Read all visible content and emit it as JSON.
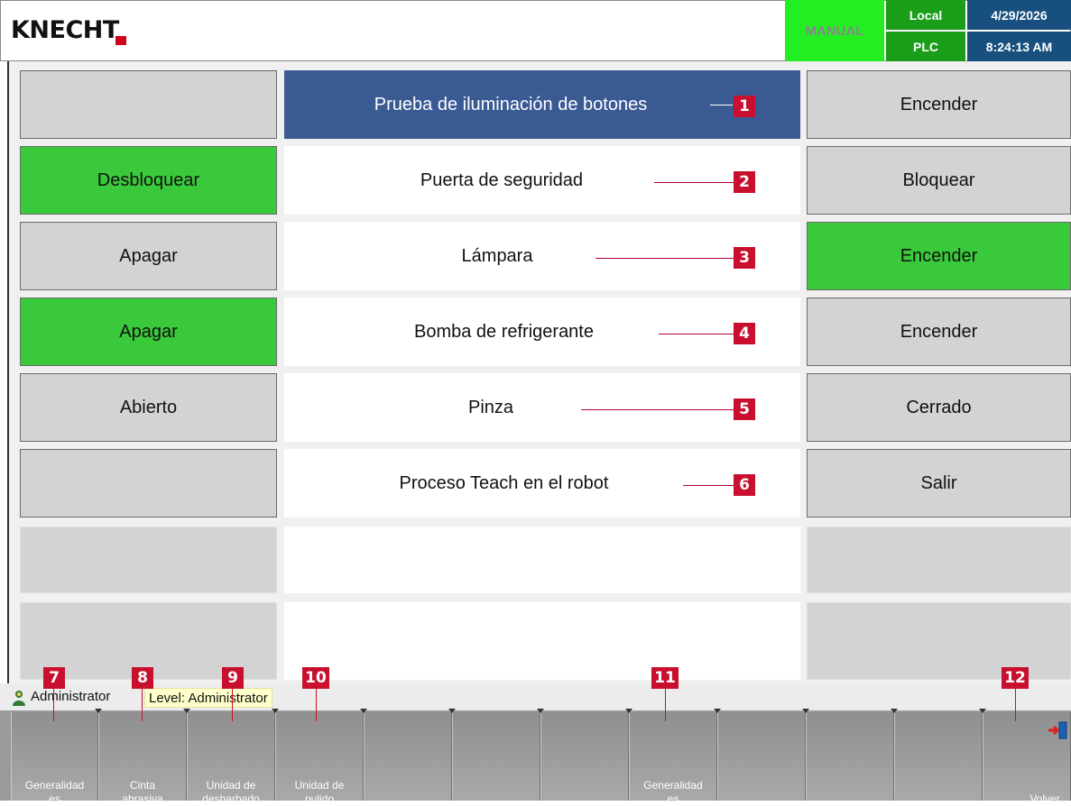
{
  "header": {
    "logo_text": "KNECHT",
    "mode": "MANUAL",
    "location": "Local",
    "source": "PLC",
    "date": "4/29/2026",
    "time": "8:24:13 AM"
  },
  "rows": [
    {
      "left": "",
      "left_state": "gray",
      "label": "Prueba de iluminación de botones",
      "right": "Encender",
      "right_state": "gray",
      "callout": "1",
      "highlight": true
    },
    {
      "left": "Desbloquear",
      "left_state": "green",
      "label": "Puerta de seguridad",
      "right": "Bloquear",
      "right_state": "gray",
      "callout": "2"
    },
    {
      "left": "Apagar",
      "left_state": "gray",
      "label": "Lámpara",
      "right": "Encender",
      "right_state": "green",
      "callout": "3"
    },
    {
      "left": "Apagar",
      "left_state": "green",
      "label": "Bomba de refrigerante",
      "right": "Encender",
      "right_state": "gray",
      "callout": "4"
    },
    {
      "left": "Abierto",
      "left_state": "gray",
      "label": "Pinza",
      "right": "Cerrado",
      "right_state": "gray",
      "callout": "5"
    },
    {
      "left": "",
      "left_state": "gray",
      "label": "Proceso Teach en el robot",
      "right": "Salir",
      "right_state": "gray",
      "callout": "6"
    }
  ],
  "status": {
    "user": "Administrator",
    "level": "Level: Administrator"
  },
  "function_keys": [
    {
      "label_1": "Generalidad",
      "label_2": "es"
    },
    {
      "label_1": "Cinta",
      "label_2": "abrasiva"
    },
    {
      "label_1": "Unidad de",
      "label_2": "desbarbado"
    },
    {
      "label_1": "Unidad de",
      "label_2": "pulido"
    },
    {
      "label_1": "",
      "label_2": ""
    },
    {
      "label_1": "",
      "label_2": ""
    },
    {
      "label_1": "",
      "label_2": ""
    },
    {
      "label_1": "Generalidad",
      "label_2": "es"
    },
    {
      "label_1": "",
      "label_2": ""
    },
    {
      "label_1": "",
      "label_2": ""
    },
    {
      "label_1": "",
      "label_2": ""
    },
    {
      "label_1": "",
      "label_2": "Volver"
    }
  ],
  "callouts_bottom": [
    "7",
    "8",
    "9",
    "10",
    "11",
    "12"
  ],
  "colors": {
    "green": "#3ac93a",
    "highlight_blue": "#3a5a94",
    "callout_red": "#c8102e",
    "header_blue": "#17507f"
  }
}
